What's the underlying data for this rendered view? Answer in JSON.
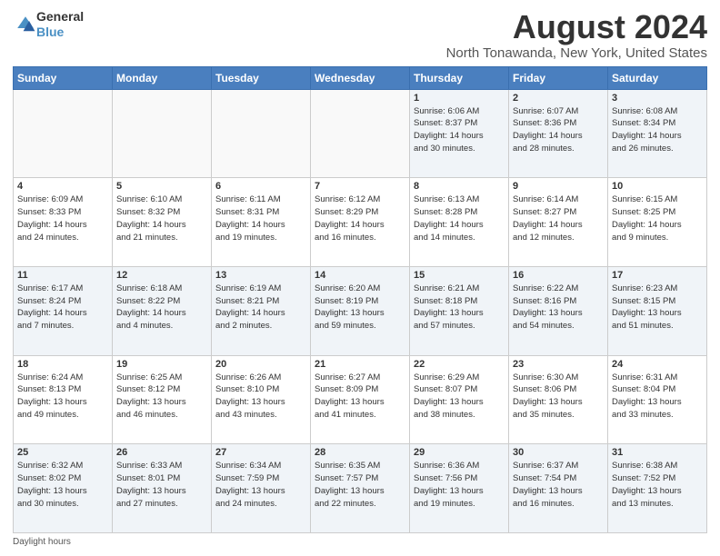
{
  "header": {
    "logo_general": "General",
    "logo_blue": "Blue",
    "month_title": "August 2024",
    "location": "North Tonawanda, New York, United States"
  },
  "weekdays": [
    "Sunday",
    "Monday",
    "Tuesday",
    "Wednesday",
    "Thursday",
    "Friday",
    "Saturday"
  ],
  "weeks": [
    [
      {
        "day": "",
        "info": ""
      },
      {
        "day": "",
        "info": ""
      },
      {
        "day": "",
        "info": ""
      },
      {
        "day": "",
        "info": ""
      },
      {
        "day": "1",
        "info": "Sunrise: 6:06 AM\nSunset: 8:37 PM\nDaylight: 14 hours\nand 30 minutes."
      },
      {
        "day": "2",
        "info": "Sunrise: 6:07 AM\nSunset: 8:36 PM\nDaylight: 14 hours\nand 28 minutes."
      },
      {
        "day": "3",
        "info": "Sunrise: 6:08 AM\nSunset: 8:34 PM\nDaylight: 14 hours\nand 26 minutes."
      }
    ],
    [
      {
        "day": "4",
        "info": "Sunrise: 6:09 AM\nSunset: 8:33 PM\nDaylight: 14 hours\nand 24 minutes."
      },
      {
        "day": "5",
        "info": "Sunrise: 6:10 AM\nSunset: 8:32 PM\nDaylight: 14 hours\nand 21 minutes."
      },
      {
        "day": "6",
        "info": "Sunrise: 6:11 AM\nSunset: 8:31 PM\nDaylight: 14 hours\nand 19 minutes."
      },
      {
        "day": "7",
        "info": "Sunrise: 6:12 AM\nSunset: 8:29 PM\nDaylight: 14 hours\nand 16 minutes."
      },
      {
        "day": "8",
        "info": "Sunrise: 6:13 AM\nSunset: 8:28 PM\nDaylight: 14 hours\nand 14 minutes."
      },
      {
        "day": "9",
        "info": "Sunrise: 6:14 AM\nSunset: 8:27 PM\nDaylight: 14 hours\nand 12 minutes."
      },
      {
        "day": "10",
        "info": "Sunrise: 6:15 AM\nSunset: 8:25 PM\nDaylight: 14 hours\nand 9 minutes."
      }
    ],
    [
      {
        "day": "11",
        "info": "Sunrise: 6:17 AM\nSunset: 8:24 PM\nDaylight: 14 hours\nand 7 minutes."
      },
      {
        "day": "12",
        "info": "Sunrise: 6:18 AM\nSunset: 8:22 PM\nDaylight: 14 hours\nand 4 minutes."
      },
      {
        "day": "13",
        "info": "Sunrise: 6:19 AM\nSunset: 8:21 PM\nDaylight: 14 hours\nand 2 minutes."
      },
      {
        "day": "14",
        "info": "Sunrise: 6:20 AM\nSunset: 8:19 PM\nDaylight: 13 hours\nand 59 minutes."
      },
      {
        "day": "15",
        "info": "Sunrise: 6:21 AM\nSunset: 8:18 PM\nDaylight: 13 hours\nand 57 minutes."
      },
      {
        "day": "16",
        "info": "Sunrise: 6:22 AM\nSunset: 8:16 PM\nDaylight: 13 hours\nand 54 minutes."
      },
      {
        "day": "17",
        "info": "Sunrise: 6:23 AM\nSunset: 8:15 PM\nDaylight: 13 hours\nand 51 minutes."
      }
    ],
    [
      {
        "day": "18",
        "info": "Sunrise: 6:24 AM\nSunset: 8:13 PM\nDaylight: 13 hours\nand 49 minutes."
      },
      {
        "day": "19",
        "info": "Sunrise: 6:25 AM\nSunset: 8:12 PM\nDaylight: 13 hours\nand 46 minutes."
      },
      {
        "day": "20",
        "info": "Sunrise: 6:26 AM\nSunset: 8:10 PM\nDaylight: 13 hours\nand 43 minutes."
      },
      {
        "day": "21",
        "info": "Sunrise: 6:27 AM\nSunset: 8:09 PM\nDaylight: 13 hours\nand 41 minutes."
      },
      {
        "day": "22",
        "info": "Sunrise: 6:29 AM\nSunset: 8:07 PM\nDaylight: 13 hours\nand 38 minutes."
      },
      {
        "day": "23",
        "info": "Sunrise: 6:30 AM\nSunset: 8:06 PM\nDaylight: 13 hours\nand 35 minutes."
      },
      {
        "day": "24",
        "info": "Sunrise: 6:31 AM\nSunset: 8:04 PM\nDaylight: 13 hours\nand 33 minutes."
      }
    ],
    [
      {
        "day": "25",
        "info": "Sunrise: 6:32 AM\nSunset: 8:02 PM\nDaylight: 13 hours\nand 30 minutes."
      },
      {
        "day": "26",
        "info": "Sunrise: 6:33 AM\nSunset: 8:01 PM\nDaylight: 13 hours\nand 27 minutes."
      },
      {
        "day": "27",
        "info": "Sunrise: 6:34 AM\nSunset: 7:59 PM\nDaylight: 13 hours\nand 24 minutes."
      },
      {
        "day": "28",
        "info": "Sunrise: 6:35 AM\nSunset: 7:57 PM\nDaylight: 13 hours\nand 22 minutes."
      },
      {
        "day": "29",
        "info": "Sunrise: 6:36 AM\nSunset: 7:56 PM\nDaylight: 13 hours\nand 19 minutes."
      },
      {
        "day": "30",
        "info": "Sunrise: 6:37 AM\nSunset: 7:54 PM\nDaylight: 13 hours\nand 16 minutes."
      },
      {
        "day": "31",
        "info": "Sunrise: 6:38 AM\nSunset: 7:52 PM\nDaylight: 13 hours\nand 13 minutes."
      }
    ]
  ],
  "footer": {
    "daylight_label": "Daylight hours"
  }
}
